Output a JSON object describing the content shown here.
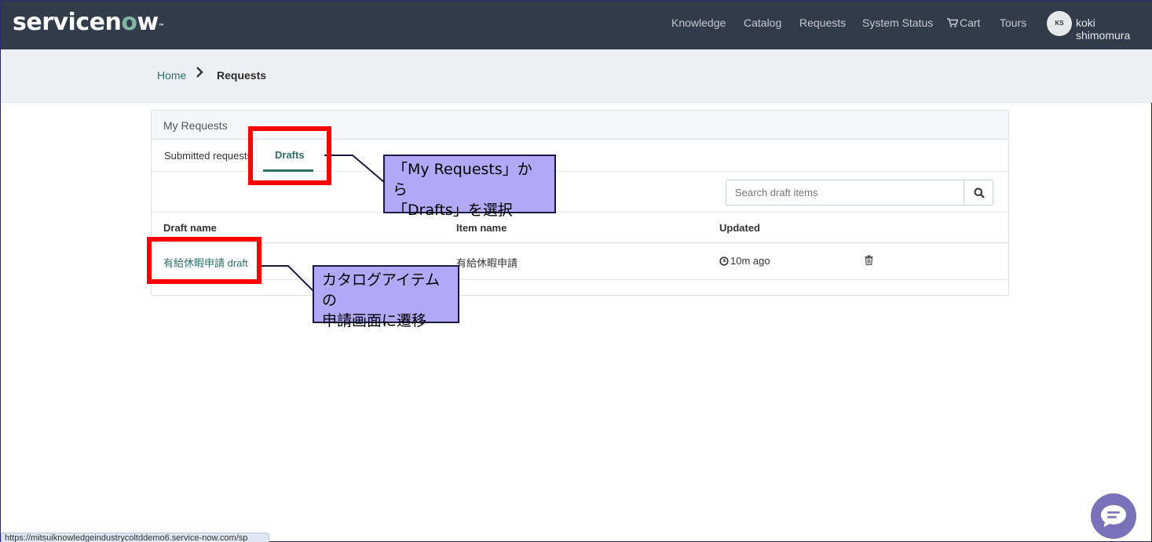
{
  "header": {
    "logo_text_a": "servicen",
    "logo_text_o": "o",
    "logo_text_b": "w",
    "logo_tm": "™",
    "nav": [
      "Knowledge",
      "Catalog",
      "Requests",
      "System Status",
      "Cart",
      "Tours"
    ],
    "avatar_initials": "KS",
    "user_name": "koki shimomura"
  },
  "breadcrumb": {
    "home": "Home",
    "current": "Requests"
  },
  "panel": {
    "title": "My Requests",
    "tabs": [
      "Submitted requests",
      "Drafts"
    ],
    "active_tab": "Drafts",
    "search_placeholder": "Search draft items",
    "columns": [
      "Draft name",
      "Item name",
      "Updated"
    ],
    "rows": [
      {
        "draft_name": "有給休暇申請 draft",
        "item_name": "有給休暇申請",
        "updated": "10m ago"
      }
    ]
  },
  "annotations": {
    "callout1_line1": "「My Requests」から",
    "callout1_line2": "「Drafts」を選択",
    "callout2_line1": "カタログアイテムの",
    "callout2_line2": "申請画面に遷移"
  },
  "statusbar": {
    "url": "https://mitsuiknowledgeindustrycoltddemo6.service-now.com/sp"
  },
  "colors": {
    "header_bg": "#323b4a",
    "accent": "#2e6f6a",
    "annotation_red": "#ff0000",
    "callout_bg": "#b3a7f7"
  }
}
